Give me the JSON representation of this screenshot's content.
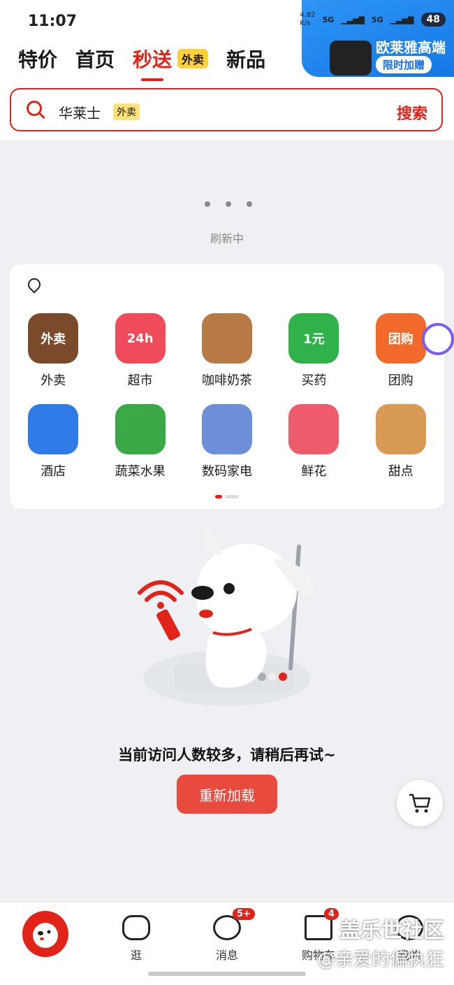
{
  "status_bar": {
    "time": "11:07",
    "speed": "4.82\nK/s",
    "net1": "5G",
    "net2": "5G",
    "battery": "48"
  },
  "top_tabs": [
    {
      "label": "特价",
      "active": false
    },
    {
      "label": "首页",
      "active": false
    },
    {
      "label": "秒送",
      "active": true
    },
    {
      "label": "新品",
      "active": false
    }
  ],
  "tab_badge": "外卖",
  "promo": {
    "title": "欧莱雅高端",
    "pill": "限时加赠"
  },
  "search": {
    "value": "华莱士",
    "tag": "外卖",
    "button": "搜索"
  },
  "refresh": {
    "text": "刷新中"
  },
  "services": [
    {
      "label": "外卖",
      "icon": "takeout-bag-icon",
      "icon_text": "外卖",
      "color": "#7a4a2a"
    },
    {
      "label": "超市",
      "icon": "supermarket-icon",
      "icon_text": "24h",
      "color": "#ef4b5a"
    },
    {
      "label": "咖啡奶茶",
      "icon": "coffee-cup-icon",
      "icon_text": "",
      "color": "#b87a45"
    },
    {
      "label": "买药",
      "icon": "medicine-box-icon",
      "icon_text": "1元",
      "color": "#2fb24a"
    },
    {
      "label": "团购",
      "icon": "group-buy-ticket-icon",
      "icon_text": "团购",
      "color": "#f26a2b"
    },
    {
      "label": "酒店",
      "icon": "hotel-building-icon",
      "icon_text": "",
      "color": "#2f7be8"
    },
    {
      "label": "蔬菜水果",
      "icon": "vegetable-icon",
      "icon_text": "",
      "color": "#3aa844"
    },
    {
      "label": "数码家电",
      "icon": "phone-fan-icon",
      "icon_text": "",
      "color": "#6d8fd8"
    },
    {
      "label": "鲜花",
      "icon": "rose-icon",
      "icon_text": "",
      "color": "#ee5b6d"
    },
    {
      "label": "甜点",
      "icon": "cake-icon",
      "icon_text": "",
      "color": "#d99a55"
    }
  ],
  "error": {
    "message": "当前访问人数较多，请稍后再试~",
    "reload_button": "重新加载"
  },
  "bottom_nav": [
    {
      "label": "",
      "icon": "jd-home-icon"
    },
    {
      "label": "逛",
      "icon": "browse-icon"
    },
    {
      "label": "消息",
      "icon": "message-icon",
      "badge": "5+"
    },
    {
      "label": "购物车",
      "icon": "cart-icon",
      "badge": "4"
    },
    {
      "label": "我的",
      "icon": "profile-icon"
    }
  ],
  "watermark": {
    "line1": "盖乐世社区",
    "line2": "@亲爱的偏执狂"
  },
  "colors": {
    "brand_red": "#e2231a",
    "promo_blue": "#1478e6",
    "reload_red": "#e84a3d"
  }
}
